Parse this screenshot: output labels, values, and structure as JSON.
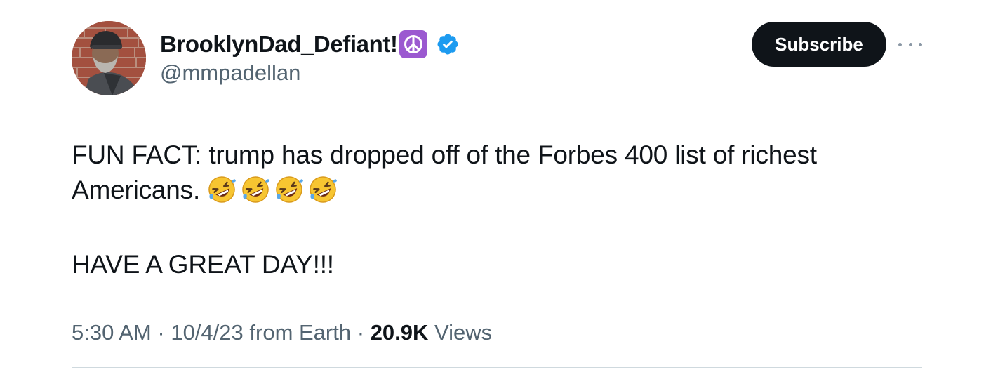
{
  "author": {
    "display_name": "BrooklynDad_Defiant!",
    "handle": "@mmpadellan",
    "badge_icon": "peace-symbol-icon",
    "verified_icon": "verified-badge-icon",
    "verified_color": "#1d9bf0"
  },
  "actions": {
    "subscribe_label": "Subscribe",
    "more_icon": "more-options-icon"
  },
  "tweet": {
    "line1": "FUN FACT: trump has dropped off of the Forbes 400 list of richest",
    "line2": "Americans.",
    "emoji_name": "rolling-on-floor-laughing-emoji",
    "emoji_count": 4,
    "line3": "HAVE A GREAT DAY!!!"
  },
  "meta": {
    "time": "5:30 AM",
    "separator": "·",
    "date": "10/4/23",
    "source": "from Earth",
    "views_count": "20.9K",
    "views_label": "Views"
  },
  "colors": {
    "text_primary": "#0f1419",
    "text_secondary": "#536471",
    "button_bg": "#0f1419",
    "peace_badge_bg": "#9b59d0"
  }
}
